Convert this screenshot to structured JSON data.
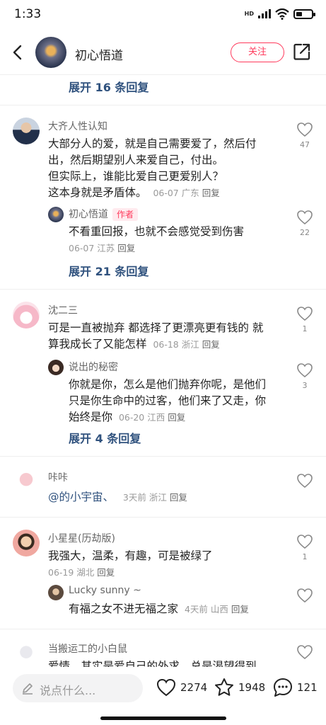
{
  "status": {
    "time": "1:33",
    "hd": "HD"
  },
  "header": {
    "title": "初心悟道",
    "follow_label": "关注"
  },
  "feed": {
    "expand_top": "展开 16 条回复",
    "comments": [
      {
        "name": "大齐人性认知",
        "lines": [
          "大部分人的爱，就是自己需要爱了，然后付",
          "出，然后期望别人来爱自己，付出。",
          "但实际上，谁能比爱自己更爱别人？"
        ],
        "last_line": "这本身就是矛盾体。",
        "meta": "06-07 广东",
        "reply": "回复",
        "likes": "47",
        "sub": {
          "name": "初心悟道",
          "tag": "作者",
          "text": "不看重回报，也就不会感觉受到伤害",
          "meta": "06-07 江苏",
          "reply": "回复",
          "likes": "22"
        },
        "expand": "展开 21 条回复"
      },
      {
        "name": "沈二三",
        "lines": [
          "可是一直被抛弃 都选择了更漂亮更有钱的 就"
        ],
        "last_line": "算我成长了又能怎样",
        "meta": "06-18 浙江",
        "reply": "回复",
        "likes": "1",
        "sub": {
          "name": "说出的秘密",
          "lines": [
            "你就是你，怎么是他们抛弃你呢，是他们",
            "只是你生命中的过客，他们来了又走，你"
          ],
          "last_line": "始终是你",
          "meta": "06-20 江西",
          "reply": "回复",
          "likes": "3"
        },
        "expand": "展开 4 条回复"
      },
      {
        "name": "咔咔",
        "mention": "@的小宇宙、",
        "meta": "3天前 浙江",
        "reply": "回复"
      },
      {
        "name": "小星星(历劫版)",
        "text": "我强大，温柔，有趣，可是被绿了",
        "meta": "06-19 湖北",
        "reply": "回复",
        "likes": "1",
        "sub": {
          "name": "Lucky sunny ~",
          "text": "有福之女不进无福之家",
          "meta": "4天前 山西",
          "reply": "回复"
        }
      },
      {
        "name": "当搬运工的小白鼠",
        "text": "爱情，其实是爱自己的外求，总是渴望得到"
      }
    ]
  },
  "bottom": {
    "placeholder": "说点什么...",
    "likes": "2274",
    "favorites": "1948",
    "comments": "121"
  },
  "colors": {
    "accent": "#ff3a5c",
    "link": "#30527e"
  }
}
